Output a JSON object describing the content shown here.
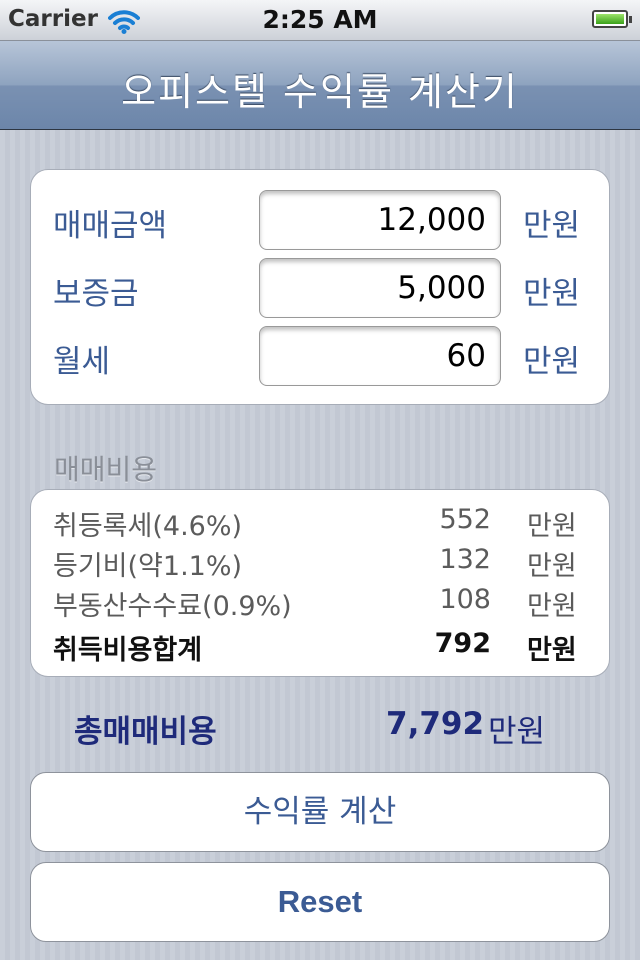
{
  "status_bar": {
    "carrier": "Carrier",
    "time": "2:25 AM",
    "battery_level": 1.0
  },
  "nav": {
    "title": "오피스텔 수익률 계산기"
  },
  "inputs": [
    {
      "label": "매매금액",
      "value": "12,000",
      "unit": "만원"
    },
    {
      "label": "보증금",
      "value": "5,000",
      "unit": "만원"
    },
    {
      "label": "월세",
      "value": "60",
      "unit": "만원"
    }
  ],
  "costs": {
    "header": "매매비용",
    "rows": [
      {
        "label": "취등록세(4.6%)",
        "value": "552",
        "unit": "만원"
      },
      {
        "label": "등기비(약1.1%)",
        "value": "132",
        "unit": "만원"
      },
      {
        "label": "부동산수수료(0.9%)",
        "value": "108",
        "unit": "만원"
      },
      {
        "label": "취득비용합계",
        "value": "792",
        "unit": "만원"
      }
    ]
  },
  "total": {
    "label": "총매매비용",
    "value": "7,792",
    "unit": "만원"
  },
  "buttons": {
    "calculate": "수익률 계산",
    "reset": "Reset"
  }
}
